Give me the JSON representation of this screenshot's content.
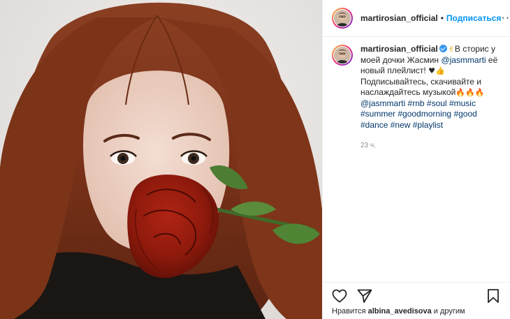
{
  "post": {
    "author": "martirosian_official",
    "header_separator": "•",
    "follow_label": "Подписаться",
    "more_label": "···",
    "caption": {
      "line1_pre": "В сторис у моей дочки Жасмин ",
      "mention": "@jasmmarti",
      "line1_post": " её новый плейлист! ",
      "heart": "♥",
      "line2": "Подписывайтесь, скачивайте и наслаждайтесь музыкой",
      "tags_mention": "@jasmmarti",
      "hashtags": [
        "#rnb",
        "#soul",
        "#music",
        "#summer",
        "#goodmorning",
        "#good",
        "#dance",
        "#new",
        "#playlist"
      ]
    },
    "timestamp": "23 ч.",
    "likes_prefix": "Нравится",
    "likes_user": "albina_avedisova",
    "likes_suffix": "и другим"
  },
  "icons": {
    "like": "heart-outline-icon",
    "share": "paper-plane-icon",
    "comment": "speech-bubble-icon",
    "save": "bookmark-icon",
    "verified": "verified-badge-icon"
  },
  "colors": {
    "follow_blue": "#0095f6",
    "link_blue": "#00376b",
    "muted": "#8e8e8e",
    "verified": "#3897f0"
  }
}
